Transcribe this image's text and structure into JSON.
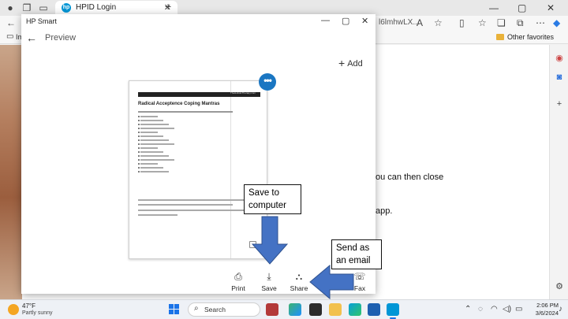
{
  "browser": {
    "tab_title": "HPID Login",
    "url_fragment": "l6lmhwLX...",
    "favorites_label": "Other favorites",
    "favbar_left_text": "Im"
  },
  "background_page": {
    "line1": "ou can then close",
    "line2": "app."
  },
  "hp_window": {
    "app_title": "HP Smart",
    "header_title": "Preview",
    "add_label": "Add",
    "document": {
      "header_text": "TheHolisticTherapy.com",
      "title": "Radical Acceptence Coping Mantras",
      "bullet_count": 15
    },
    "actions": [
      {
        "name": "print-button",
        "label": "Print",
        "icon": "printer-icon"
      },
      {
        "name": "save-button",
        "label": "Save",
        "icon": "download-icon"
      },
      {
        "name": "share-button",
        "label": "Share",
        "icon": "share-icon"
      },
      {
        "name": "fax-button",
        "label": "Fax",
        "icon": "fax-icon"
      }
    ]
  },
  "annotations": {
    "save_callout": [
      "Save to",
      "computer"
    ],
    "email_callout": [
      "Send as",
      "an email"
    ],
    "arrow_color": "#4472c4"
  },
  "taskbar": {
    "temperature": "47°F",
    "condition": "Partly sunny",
    "search_placeholder": "Search",
    "time": "2:06 PM",
    "date": "3/6/2024"
  },
  "colors": {
    "accent": "#1a76c2",
    "arrow_fill": "#4472c4"
  }
}
